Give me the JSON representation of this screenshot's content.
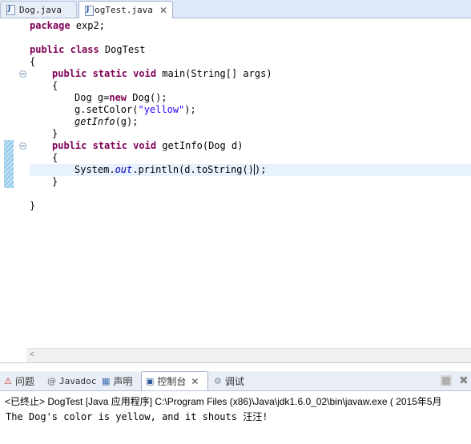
{
  "editor_tabs": [
    {
      "label": "Dog.java",
      "active": false
    },
    {
      "label": "DogTest.java",
      "active": true,
      "close": "✕"
    }
  ],
  "code": {
    "l1": {
      "kw": "package",
      "rest": " exp2;"
    },
    "l3": {
      "kw": "public class",
      "rest": " DogTest"
    },
    "l4": "{",
    "l5": {
      "kw": "public static void",
      "rest": " main(String[] args)"
    },
    "l6": "{",
    "l7": {
      "pre": "Dog g=",
      "kw": "new",
      "rest": " Dog();"
    },
    "l8": {
      "pre": "g.setColor(",
      "str": "\"yellow\"",
      "rest": ");"
    },
    "l9": {
      "it": "getInfo",
      "rest": "(g);"
    },
    "l10": "}",
    "l11": {
      "kw": "public static void",
      "rest": " getInfo(Dog d)"
    },
    "l12": "{",
    "l13": {
      "pre": "System.",
      "fld": "out",
      "mid": ".println(d.toString()",
      "post": ");"
    },
    "l14": "}",
    "l16": "}"
  },
  "console_tabs": [
    {
      "label": "问题",
      "icon": "problems-icon"
    },
    {
      "label": "Javadoc",
      "icon": "javadoc-icon"
    },
    {
      "label": "声明",
      "icon": "declaration-icon"
    },
    {
      "label": "控制台",
      "icon": "console-icon",
      "active": true,
      "close": "✕"
    },
    {
      "label": "调试",
      "icon": "debug-icon"
    }
  ],
  "console": {
    "header": "<已终止> DogTest [Java 应用程序] C:\\Program Files (x86)\\Java\\jdk1.6.0_02\\bin\\javaw.exe ( 2015年5月",
    "output": "The Dog's color is yellow, and it shouts 汪汪!"
  }
}
